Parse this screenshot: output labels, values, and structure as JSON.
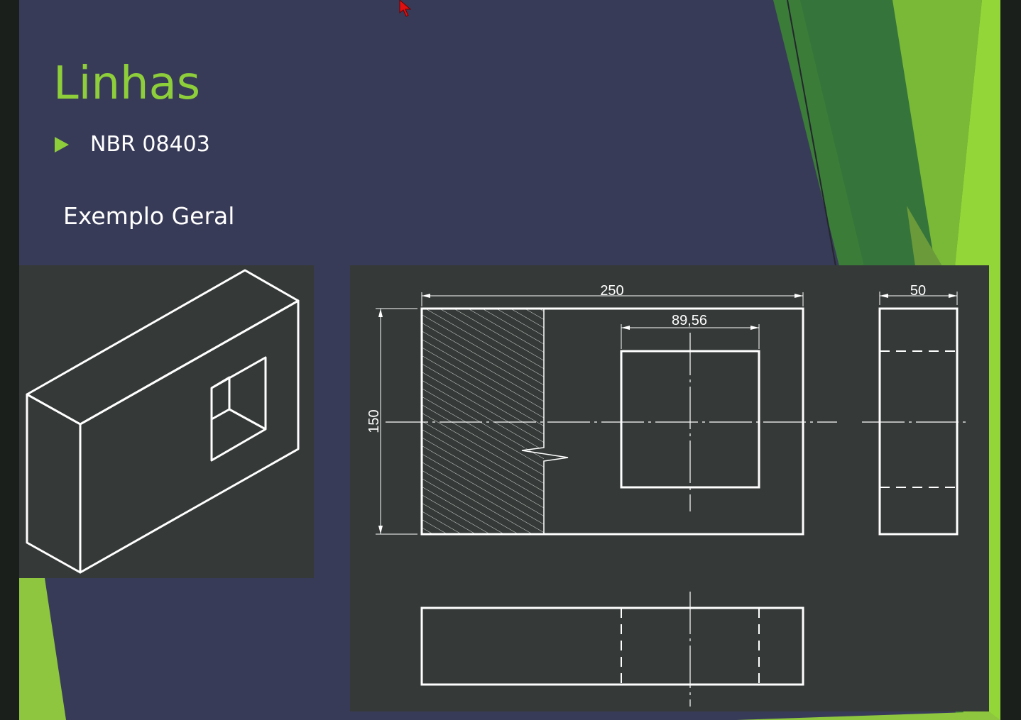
{
  "slide": {
    "title": "Linhas",
    "bullets": [
      {
        "text": "NBR 08403"
      }
    ],
    "subheading": "Exemplo Geral"
  },
  "drawing": {
    "dimensions": {
      "overall_width": "250",
      "height": "150",
      "opening_width": "89,56",
      "side_depth": "50"
    }
  },
  "colors": {
    "background": "#383b58",
    "accent_green": "#8dce3a",
    "dark_green": "#3a7c38",
    "panel": "#353a38",
    "line": "#ffffff"
  },
  "icons": {
    "bullet": "triangle-right-icon",
    "cursor": "mouse-pointer-icon"
  }
}
